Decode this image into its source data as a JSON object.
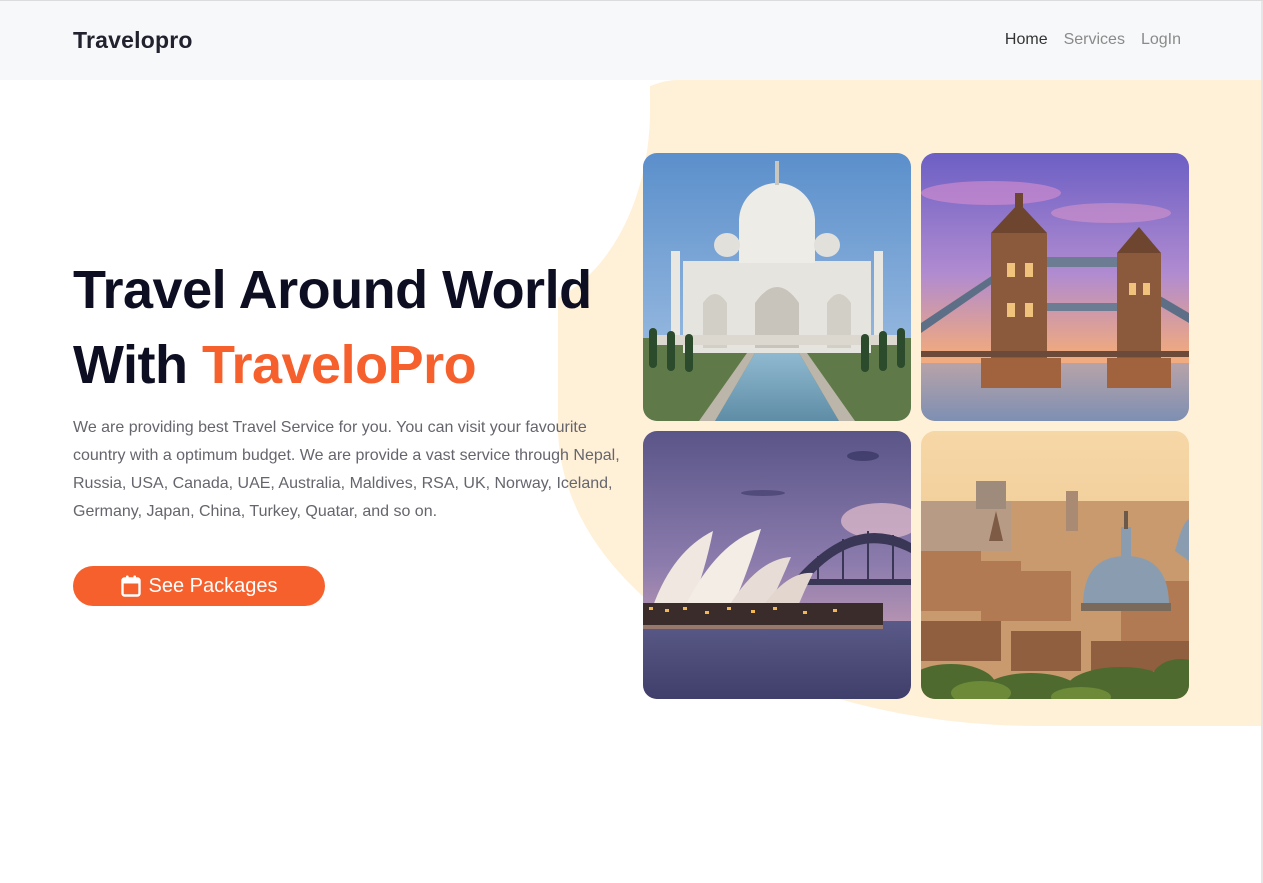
{
  "navbar": {
    "brand": "Travelopro",
    "links": [
      {
        "label": "Home",
        "active": true
      },
      {
        "label": "Services",
        "active": false
      },
      {
        "label": "LogIn",
        "active": false
      }
    ]
  },
  "hero": {
    "title_line1": "Travel Around World",
    "title_prefix": "With ",
    "title_accent": "TraveloPro",
    "description": "We are providing best Travel Service for you. You can visit your favourite country with a optimum budget. We are provide a vast service through Nepal, Russia, USA, Canada, UAE, Australia, Maldives, RSA, UK, Norway, Iceland, Germany, Japan, China, Turkey, Quatar, and so on.",
    "cta_label": "See Packages",
    "cta_icon": "calendar-icon"
  },
  "gallery": [
    {
      "name": "taj-mahal-photo"
    },
    {
      "name": "tower-bridge-photo"
    },
    {
      "name": "sydney-opera-house-photo"
    },
    {
      "name": "rome-cityscape-photo"
    }
  ],
  "colors": {
    "accent": "#f6602d",
    "heading": "#0e0e22",
    "body_text": "#65656d",
    "navbar_bg": "#f7f8f9",
    "blob_bg": "#fff0d8"
  }
}
